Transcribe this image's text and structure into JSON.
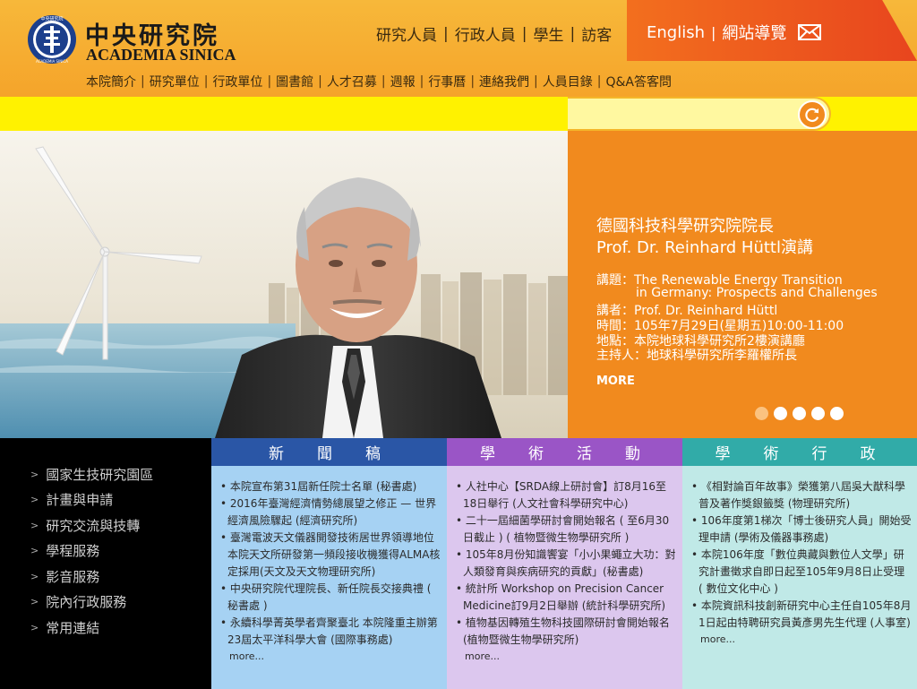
{
  "header": {
    "logo": {
      "seal_text": "中央研究院",
      "seal_text_en": "ACADEMIA SINICA",
      "name_cn": "中央研究院",
      "name_en": "ACADEMIA SINICA"
    },
    "audience_nav": [
      "研究人員",
      "行政人員",
      "學生",
      "訪客"
    ],
    "lang_nav": {
      "english": "English",
      "sitemap": "網站導覽"
    },
    "main_nav": [
      "本院簡介",
      "研究單位",
      "行政單位",
      "圖書館",
      "人才召募",
      "週報",
      "行事曆",
      "連絡我們",
      "人員目錄",
      "Q&A答客問"
    ]
  },
  "search": {
    "placeholder": "",
    "value": ""
  },
  "hero": {
    "title_cn": "德國科技科學研究院院長",
    "title_en": "Prof. Dr. Reinhard Hüttl演講",
    "topic_label": "講題：The Renewable Energy Transition",
    "topic_line2": "in Germany: Prospects and Challenges",
    "speaker": "講者：Prof. Dr. Reinhard Hüttl",
    "time": "時間：105年7月29日(星期五)10:00-11:00",
    "place": "地點：本院地球科學研究所2樓演講廳",
    "host": "主持人：地球科學研究所李羅權所長",
    "more": "MORE",
    "slide_count": 5,
    "active_slide": 1
  },
  "left_nav": [
    "國家生技研究園區",
    "計畫與申請",
    "研究交流與技轉",
    "學程服務",
    "影音服務",
    "院內行政服務",
    "常用連結"
  ],
  "columns": {
    "news": {
      "title": "新　聞　稿",
      "items": [
        "本院宣布第31屆新任院士名單 (秘書處)",
        "2016年臺灣經濟情勢總展望之修正 — 世界經濟風險驟起 (經濟研究所)",
        "臺灣電波天文儀器開發技術居世界領導地位本院天文所研發第一頻段接收機獲得ALMA核定採用(天文及天文物理研究所)",
        "中央研究院代理院長、新任院長交接典禮 ( 秘書處 )",
        "永續科學菁英學者齊聚臺北 本院隆重主辦第23屆太平洋科學大會 (國際事務處)"
      ],
      "more": "more..."
    },
    "academic": {
      "title": "學　術　活　動",
      "items": [
        "人社中心【SRDA線上研討會】訂8月16至18日舉行 (人文社會科學研究中心)",
        "二十一屆細菌學研討會開始報名 ( 至6月30日截止 ) ( 植物暨微生物學研究所 )",
        "105年8月份知識饗宴「小小果蠅立大功：對人類發育與疾病研究的貢獻」(秘書處)",
        "統計所 Workshop on Precision Cancer Medicine訂9月2日舉辦 (統計科學研究所)",
        "植物基因轉殖生物科技國際研討會開始報名 (植物暨微生物學研究所)"
      ],
      "more": "more..."
    },
    "admin": {
      "title": "學　術　行　政",
      "items": [
        "《相對論百年故事》榮獲第八屆吳大猷科學普及著作獎銀籤獎 (物理研究所)",
        "106年度第1梯次「博士後研究人員」開始受理申請 (學術及儀器事務處)",
        "本院106年度「數位典藏與數位人文學」研究計畫徵求自即日起至105年9月8日止受理 ( 數位文化中心 )",
        "本院資訊科技創新研究中心主任自105年8月1日起由特聘研究員黃彥男先生代理 (人事室)"
      ],
      "more": "more..."
    }
  },
  "colors": {
    "orange": "#f18a1e",
    "yellow": "#fff200",
    "news": "#2a56a6",
    "academic": "#9a55c6",
    "admin": "#31aba8"
  }
}
